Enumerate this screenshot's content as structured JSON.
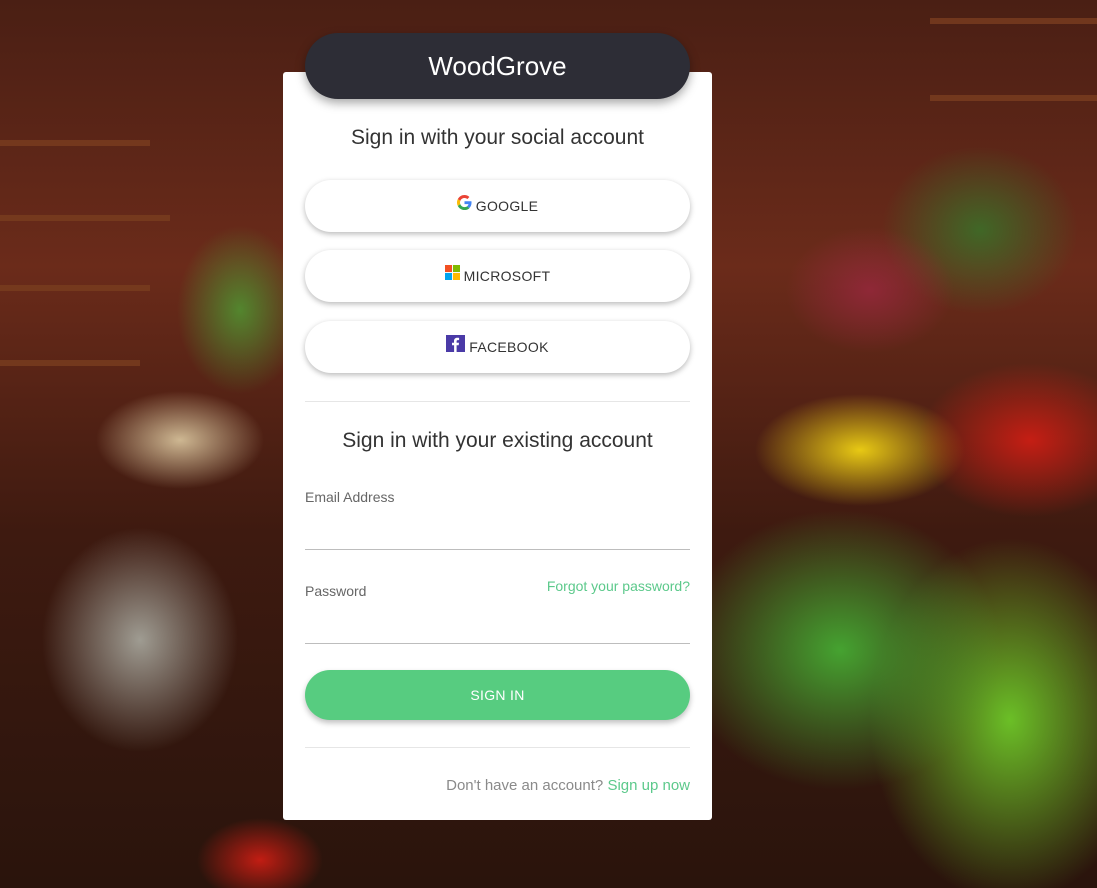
{
  "brand": {
    "name": "WoodGrove"
  },
  "social": {
    "title": "Sign in with your social account",
    "buttons": [
      {
        "label": "GOOGLE",
        "icon": "google-icon"
      },
      {
        "label": "MICROSOFT",
        "icon": "microsoft-icon"
      },
      {
        "label": "FACEBOOK",
        "icon": "facebook-icon"
      }
    ]
  },
  "local": {
    "title": "Sign in with your existing account",
    "email_label": "Email Address",
    "email_value": "",
    "password_label": "Password",
    "password_value": "",
    "forgot_label": "Forgot your password?",
    "signin_label": "SIGN IN"
  },
  "footer": {
    "prompt": "Don't have an account?",
    "signup_label": "Sign up now"
  },
  "colors": {
    "accent": "#57cc80",
    "link": "#5cc98b",
    "brand_bg": "#2d2d36",
    "facebook": "#4a3aa7"
  }
}
